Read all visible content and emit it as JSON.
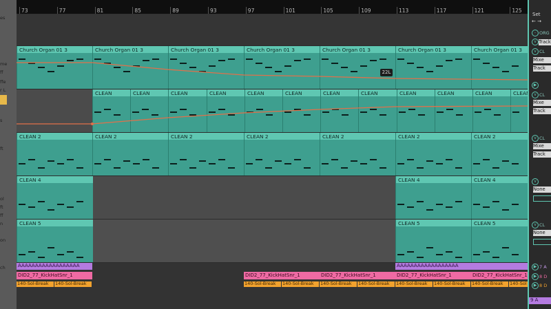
{
  "ruler": {
    "bars": [
      "73",
      "77",
      "81",
      "85",
      "89",
      "93",
      "97",
      "101",
      "105",
      "109",
      "113",
      "117",
      "121",
      "125"
    ]
  },
  "left_panel": {
    "labels": [
      "es",
      "me",
      "ff",
      "ffe",
      "r L",
      "s",
      "ft",
      "ol",
      "ft",
      "ff",
      "n",
      "on",
      "ch"
    ]
  },
  "tracks": [
    {
      "name": "Church Organ 01 3"
    },
    {
      "name": "CLEAN"
    },
    {
      "name": "CLEAN 2"
    },
    {
      "name": "CLEAN 4"
    },
    {
      "name": "CLEAN 5"
    }
  ],
  "automation_badge": "22L",
  "drum_clip_name": "DID2_77_KickHatSnr_1",
  "break_clip_name": "140-Sol-Break",
  "pattern_clip_text": "AAAAAAAAAAAAAAAAAA",
  "right_panel": {
    "set_label": "Set",
    "arrows": "← →",
    "track_labels": [
      "ORG",
      "CL",
      "CL",
      "CL",
      "CL"
    ],
    "mixer_label": "Mixe",
    "track_btn": "Track",
    "none_label": "None",
    "bottom_labels": [
      "7 A",
      "8 D",
      "8 D",
      "9 A"
    ]
  },
  "colors": {
    "clip_teal": "#5fc7b2",
    "clip_body": "#3e9f8f",
    "pink": "#ef6aa3",
    "orange": "#f2a22e",
    "purple": "#b47be0",
    "automation": "#e2704a"
  }
}
